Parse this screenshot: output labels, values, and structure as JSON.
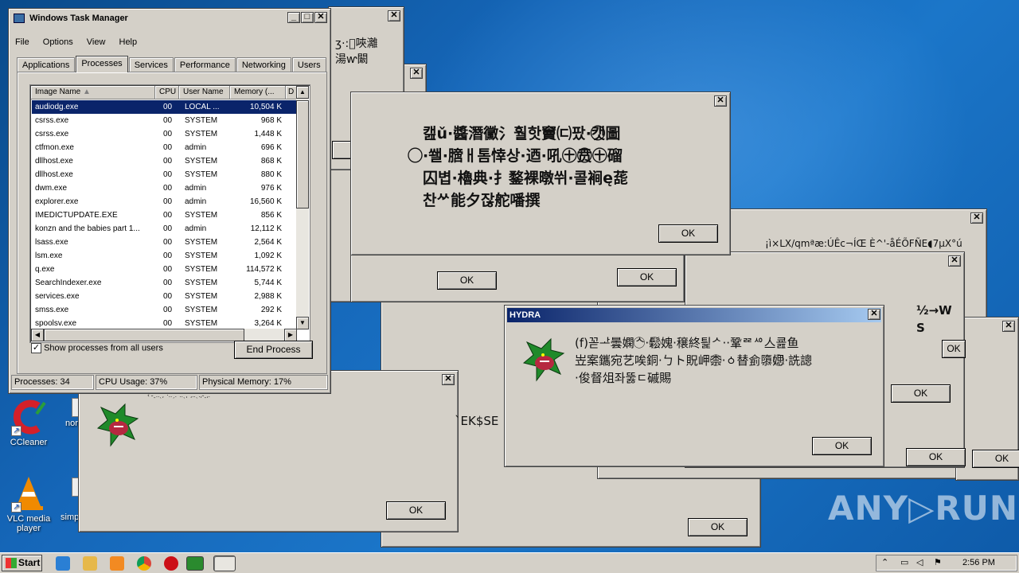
{
  "desktop": {
    "icons": [
      {
        "label": "CCleaner",
        "icon": "ccleaner-icon"
      },
      {
        "label": "VLC media player",
        "icon": "vlc-icon"
      },
      {
        "label": "nor",
        "icon": "document-icon"
      },
      {
        "label": "simp",
        "icon": "document-icon"
      }
    ],
    "watermark": "ANY▷RUN"
  },
  "dialogs": [
    {
      "id": "d1",
      "ok": "OK",
      "text": "ʒ·:⃝唊灕\n​湯ⱳ闞"
    },
    {
      "id": "d2",
      "ok": "OK",
      "text": ""
    },
    {
      "id": "d3",
      "ok": "OK",
      "text": ""
    },
    {
      "id": "d4",
      "ok": "OK",
      "text": "캞ǔ·醬潛黴氵훨핫竇㈂팠·캣⃝圖\n⃝·쐘·膪ㅐ톰悻상·迺·吼㊉贲⃝㊉磂\n囚볍·櫓典·扌鍪裸暾쒸·콜裥ę蒊\n찬ᄽ能夕잖舵噃撰"
    },
    {
      "id": "d5",
      "ok": "OK",
      "text": ""
    },
    {
      "id": "d6",
      "ok": "OK",
      "text": "¡ì×LX/qmªæ:ÚÊc¬ÍŒ   È^'-åÉÕFÑE◖7µX°ú"
    },
    {
      "id": "d7",
      "ok": "OK",
      "text": "½→W S"
    },
    {
      "id": "d8",
      "ok": "OK",
      "text": "ˋEK$SE"
    },
    {
      "id": "d9",
      "ok": "OK",
      "text": "‹ ˶ˍ..ˎ,ˊ·..ˏ.ˋ..ˎ,ˊ,..ˎ.,˶ˍ,."
    },
    {
      "id": "hydra",
      "title": "HYDRA",
      "ok": "OK",
      "text": "(f)꼳ᅶ曇嫻ᄾ⃝·鬆⃝媿·穣終틡ᄼ··鞏ᄙᄵ亼쿒鱼\n岦案鑴宛艺唉銅·ㄅト貺岬柰⃝·ㆁ替侴隳媤⃝·詵謥\n·俊督俎좌뚫ㄷ磩賜"
    }
  ],
  "taskmgr": {
    "title": "Windows Task Manager",
    "menu": [
      "File",
      "Options",
      "View",
      "Help"
    ],
    "tabs": [
      "Applications",
      "Processes",
      "Services",
      "Performance",
      "Networking",
      "Users"
    ],
    "selected_tab": "Processes",
    "columns": [
      "Image Name",
      "CPU",
      "User Name",
      "Memory (...",
      "D"
    ],
    "rows": [
      {
        "name": "audiodg.exe",
        "cpu": "00",
        "user": "LOCAL ...",
        "mem": "10,504 K",
        "selected": true
      },
      {
        "name": "csrss.exe",
        "cpu": "00",
        "user": "SYSTEM",
        "mem": "968 K"
      },
      {
        "name": "csrss.exe",
        "cpu": "00",
        "user": "SYSTEM",
        "mem": "1,448 K"
      },
      {
        "name": "ctfmon.exe",
        "cpu": "00",
        "user": "admin",
        "mem": "696 K"
      },
      {
        "name": "dllhost.exe",
        "cpu": "00",
        "user": "SYSTEM",
        "mem": "868 K"
      },
      {
        "name": "dllhost.exe",
        "cpu": "00",
        "user": "SYSTEM",
        "mem": "880 K"
      },
      {
        "name": "dwm.exe",
        "cpu": "00",
        "user": "admin",
        "mem": "976 K"
      },
      {
        "name": "explorer.exe",
        "cpu": "00",
        "user": "admin",
        "mem": "16,560 K"
      },
      {
        "name": "IMEDICTUPDATE.EXE",
        "cpu": "00",
        "user": "SYSTEM",
        "mem": "856 K"
      },
      {
        "name": "konzn and the babies part 1...",
        "cpu": "00",
        "user": "admin",
        "mem": "12,112 K"
      },
      {
        "name": "lsass.exe",
        "cpu": "00",
        "user": "SYSTEM",
        "mem": "2,564 K"
      },
      {
        "name": "lsm.exe",
        "cpu": "00",
        "user": "SYSTEM",
        "mem": "1,092 K"
      },
      {
        "name": "q.exe",
        "cpu": "00",
        "user": "SYSTEM",
        "mem": "114,572 K"
      },
      {
        "name": "SearchIndexer.exe",
        "cpu": "00",
        "user": "SYSTEM",
        "mem": "5,744 K"
      },
      {
        "name": "services.exe",
        "cpu": "00",
        "user": "SYSTEM",
        "mem": "2,988 K"
      },
      {
        "name": "smss.exe",
        "cpu": "00",
        "user": "SYSTEM",
        "mem": "292 K"
      },
      {
        "name": "spoolsv.exe",
        "cpu": "00",
        "user": "SYSTEM",
        "mem": "3,264 K"
      }
    ],
    "show_all_label": "Show processes from all users",
    "show_all_checked": true,
    "end_process": "End Process",
    "status": {
      "processes": "Processes: 34",
      "cpu": "CPU Usage: 37%",
      "memory": "Physical Memory: 17%"
    }
  },
  "taskbar": {
    "start": "Start",
    "clock": "2:56 PM",
    "pinned": [
      "ie-icon",
      "explorer-icon",
      "media-player-icon",
      "chrome-icon",
      "opera-icon",
      "hydra-icon",
      "task-manager-icon"
    ]
  },
  "colors": {
    "desktop": "#1566b8",
    "window": "#d4d0c8",
    "titlebar_active": "#0a246a",
    "selection": "#0a246a"
  }
}
